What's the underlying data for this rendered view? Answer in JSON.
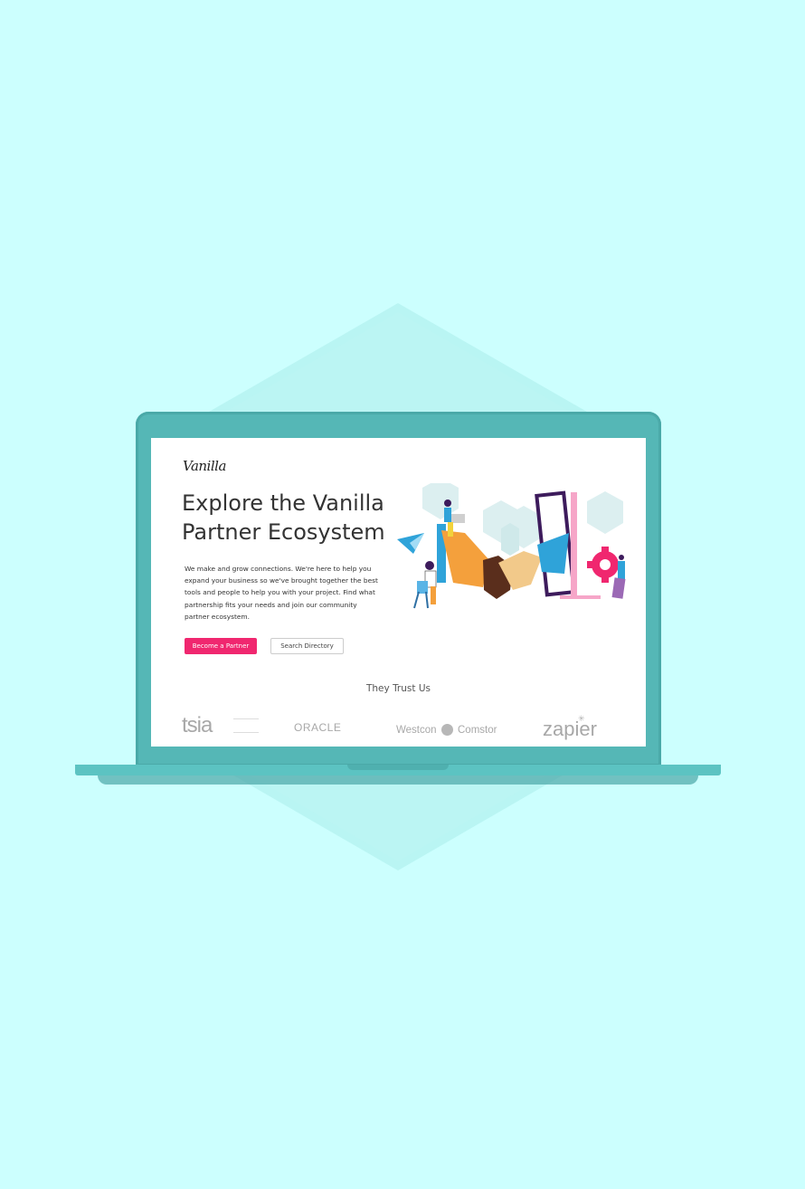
{
  "site": {
    "logo_text": "Vanilla",
    "headline": "Explore the Vanilla Partner Ecosystem",
    "description": "We make and grow connections. We're here to help you expand your business so we've brought together the best tools and people to help you with your project. Find what partnership fits your needs and join our community partner ecosystem.",
    "buttons": {
      "primary": "Become a Partner",
      "secondary": "Search Directory"
    },
    "trust_heading": "They Trust Us",
    "partners": [
      "tsia",
      "ORACLE",
      "Westcon",
      "Comstor",
      "zapier"
    ]
  },
  "colors": {
    "background": "#ccfffe",
    "laptop": "#55b7b6",
    "accent_pink": "#f0276f",
    "illustration_orange": "#f4a03c",
    "illustration_blue": "#2fa3d9",
    "illustration_purple": "#3d1b5c"
  }
}
